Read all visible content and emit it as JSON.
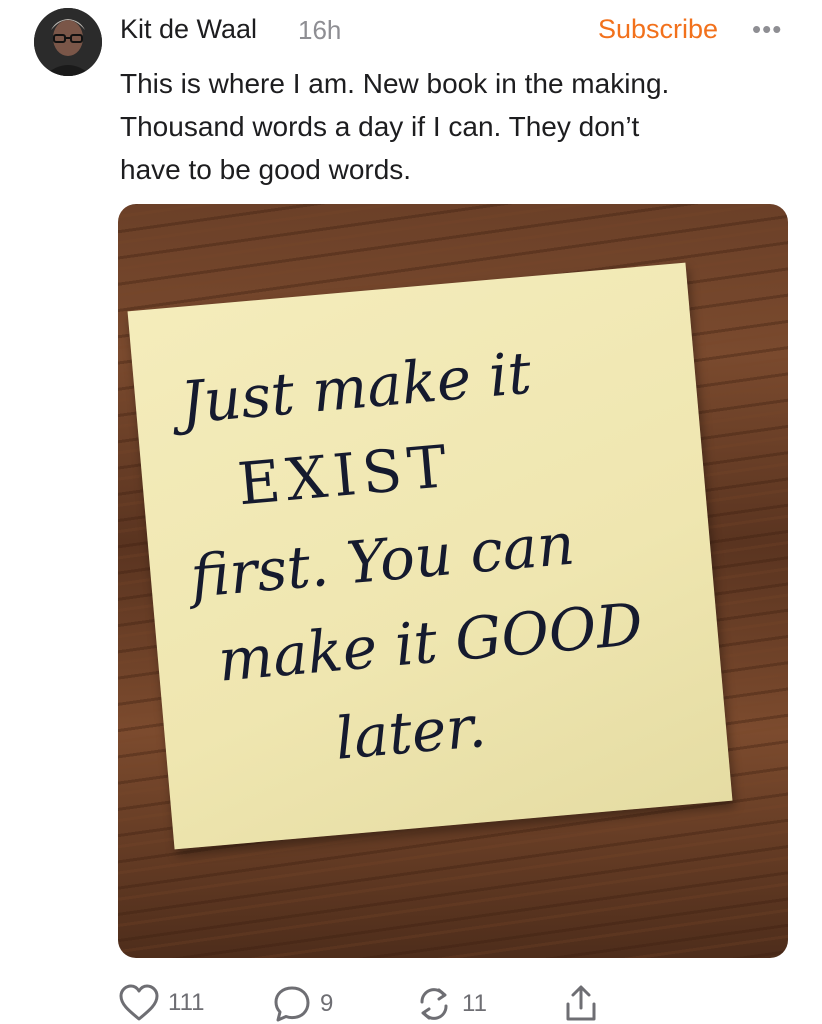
{
  "post": {
    "author": "Kit de Waal",
    "time": "16h",
    "subscribe_label": "Subscribe",
    "more_label": "•••",
    "text": "This is where I am.  New book in the making.\nThousand words a day if I can.  They don’t\nhave to be good words.",
    "photo": {
      "note_lines": [
        "Just make it",
        "EXIST",
        "first. You can",
        "make it GOOD",
        "later."
      ]
    }
  },
  "actions": {
    "likes": "111",
    "comments": "9",
    "restacks": "11"
  },
  "colors": {
    "accent": "#f2711c",
    "muted": "#8e8e93"
  },
  "icons": [
    "avatar",
    "heart-icon",
    "comment-icon",
    "restack-icon",
    "share-icon"
  ]
}
